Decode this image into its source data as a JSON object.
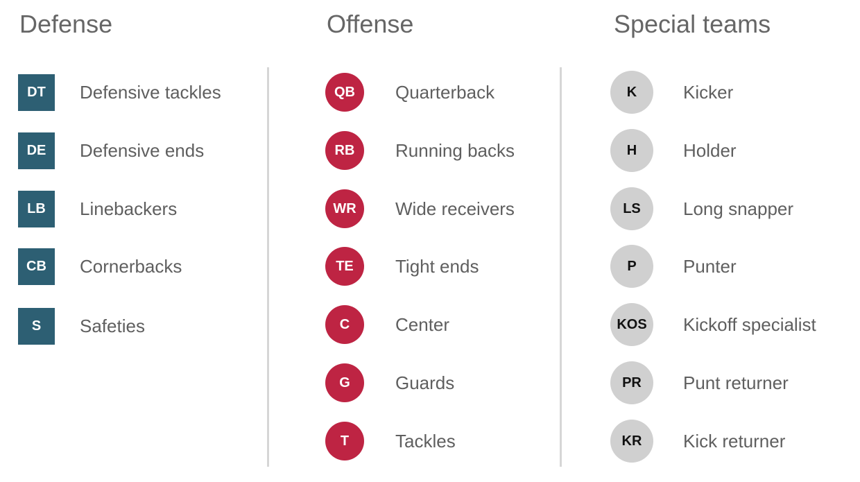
{
  "colors": {
    "defense": "#2d5f73",
    "offense": "#be2443",
    "special": "#d0d0d0"
  },
  "defense": {
    "title": "Defense",
    "items": [
      {
        "abbr": "DT",
        "label": "Defensive tackles"
      },
      {
        "abbr": "DE",
        "label": "Defensive ends"
      },
      {
        "abbr": "LB",
        "label": "Linebackers"
      },
      {
        "abbr": "CB",
        "label": "Cornerbacks"
      },
      {
        "abbr": "S",
        "label": "Safeties"
      }
    ]
  },
  "offense": {
    "title": "Offense",
    "items": [
      {
        "abbr": "QB",
        "label": "Quarterback"
      },
      {
        "abbr": "RB",
        "label": "Running backs"
      },
      {
        "abbr": "WR",
        "label": "Wide receivers"
      },
      {
        "abbr": "TE",
        "label": "Tight ends"
      },
      {
        "abbr": "C",
        "label": "Center"
      },
      {
        "abbr": "G",
        "label": "Guards"
      },
      {
        "abbr": "T",
        "label": "Tackles"
      }
    ]
  },
  "special": {
    "title": "Special teams",
    "items": [
      {
        "abbr": "K",
        "label": "Kicker"
      },
      {
        "abbr": "H",
        "label": "Holder"
      },
      {
        "abbr": "LS",
        "label": "Long snapper"
      },
      {
        "abbr": "P",
        "label": "Punter"
      },
      {
        "abbr": "KOS",
        "label": "Kickoff specialist"
      },
      {
        "abbr": "PR",
        "label": "Punt returner"
      },
      {
        "abbr": "KR",
        "label": "Kick returner"
      }
    ]
  }
}
